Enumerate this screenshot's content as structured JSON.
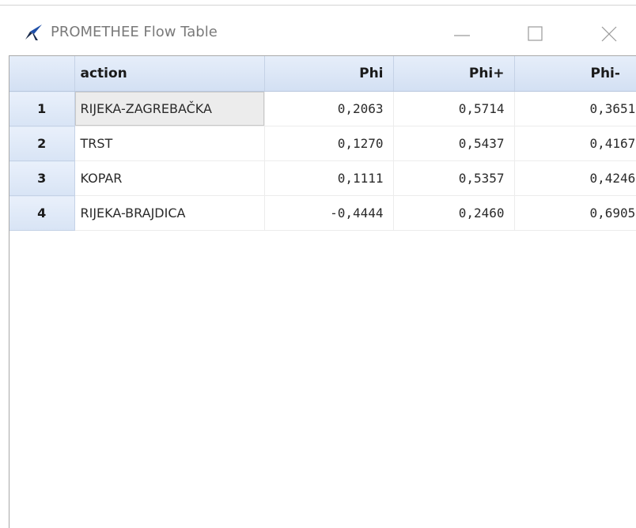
{
  "window": {
    "title": "PROMETHEE Flow Table",
    "app_icon": "promethee-logo-icon",
    "controls": {
      "minimize": "minimize-icon",
      "maximize": "maximize-icon",
      "close": "close-icon"
    }
  },
  "table": {
    "columns": [
      "",
      "action",
      "Phi",
      "Phi+",
      "Phi-"
    ],
    "rows": [
      {
        "index": "1",
        "action": "RIJEKA-ZAGREBAČKA",
        "phi": "0,2063",
        "phi_plus": "0,5714",
        "phi_minus": "0,3651"
      },
      {
        "index": "2",
        "action": "TRST",
        "phi": "0,1270",
        "phi_plus": "0,5437",
        "phi_minus": "0,4167"
      },
      {
        "index": "3",
        "action": "KOPAR",
        "phi": "0,1111",
        "phi_plus": "0,5357",
        "phi_minus": "0,4246"
      },
      {
        "index": "4",
        "action": "RIJEKA-BRAJDICA",
        "phi": "-0,4444",
        "phi_plus": "0,2460",
        "phi_minus": "0,6905"
      }
    ],
    "selected_row": 1
  },
  "colors": {
    "header_bg": "#d9e4f4",
    "title_text": "#7a7a7a",
    "icon_blue": "#1f4fa8"
  }
}
